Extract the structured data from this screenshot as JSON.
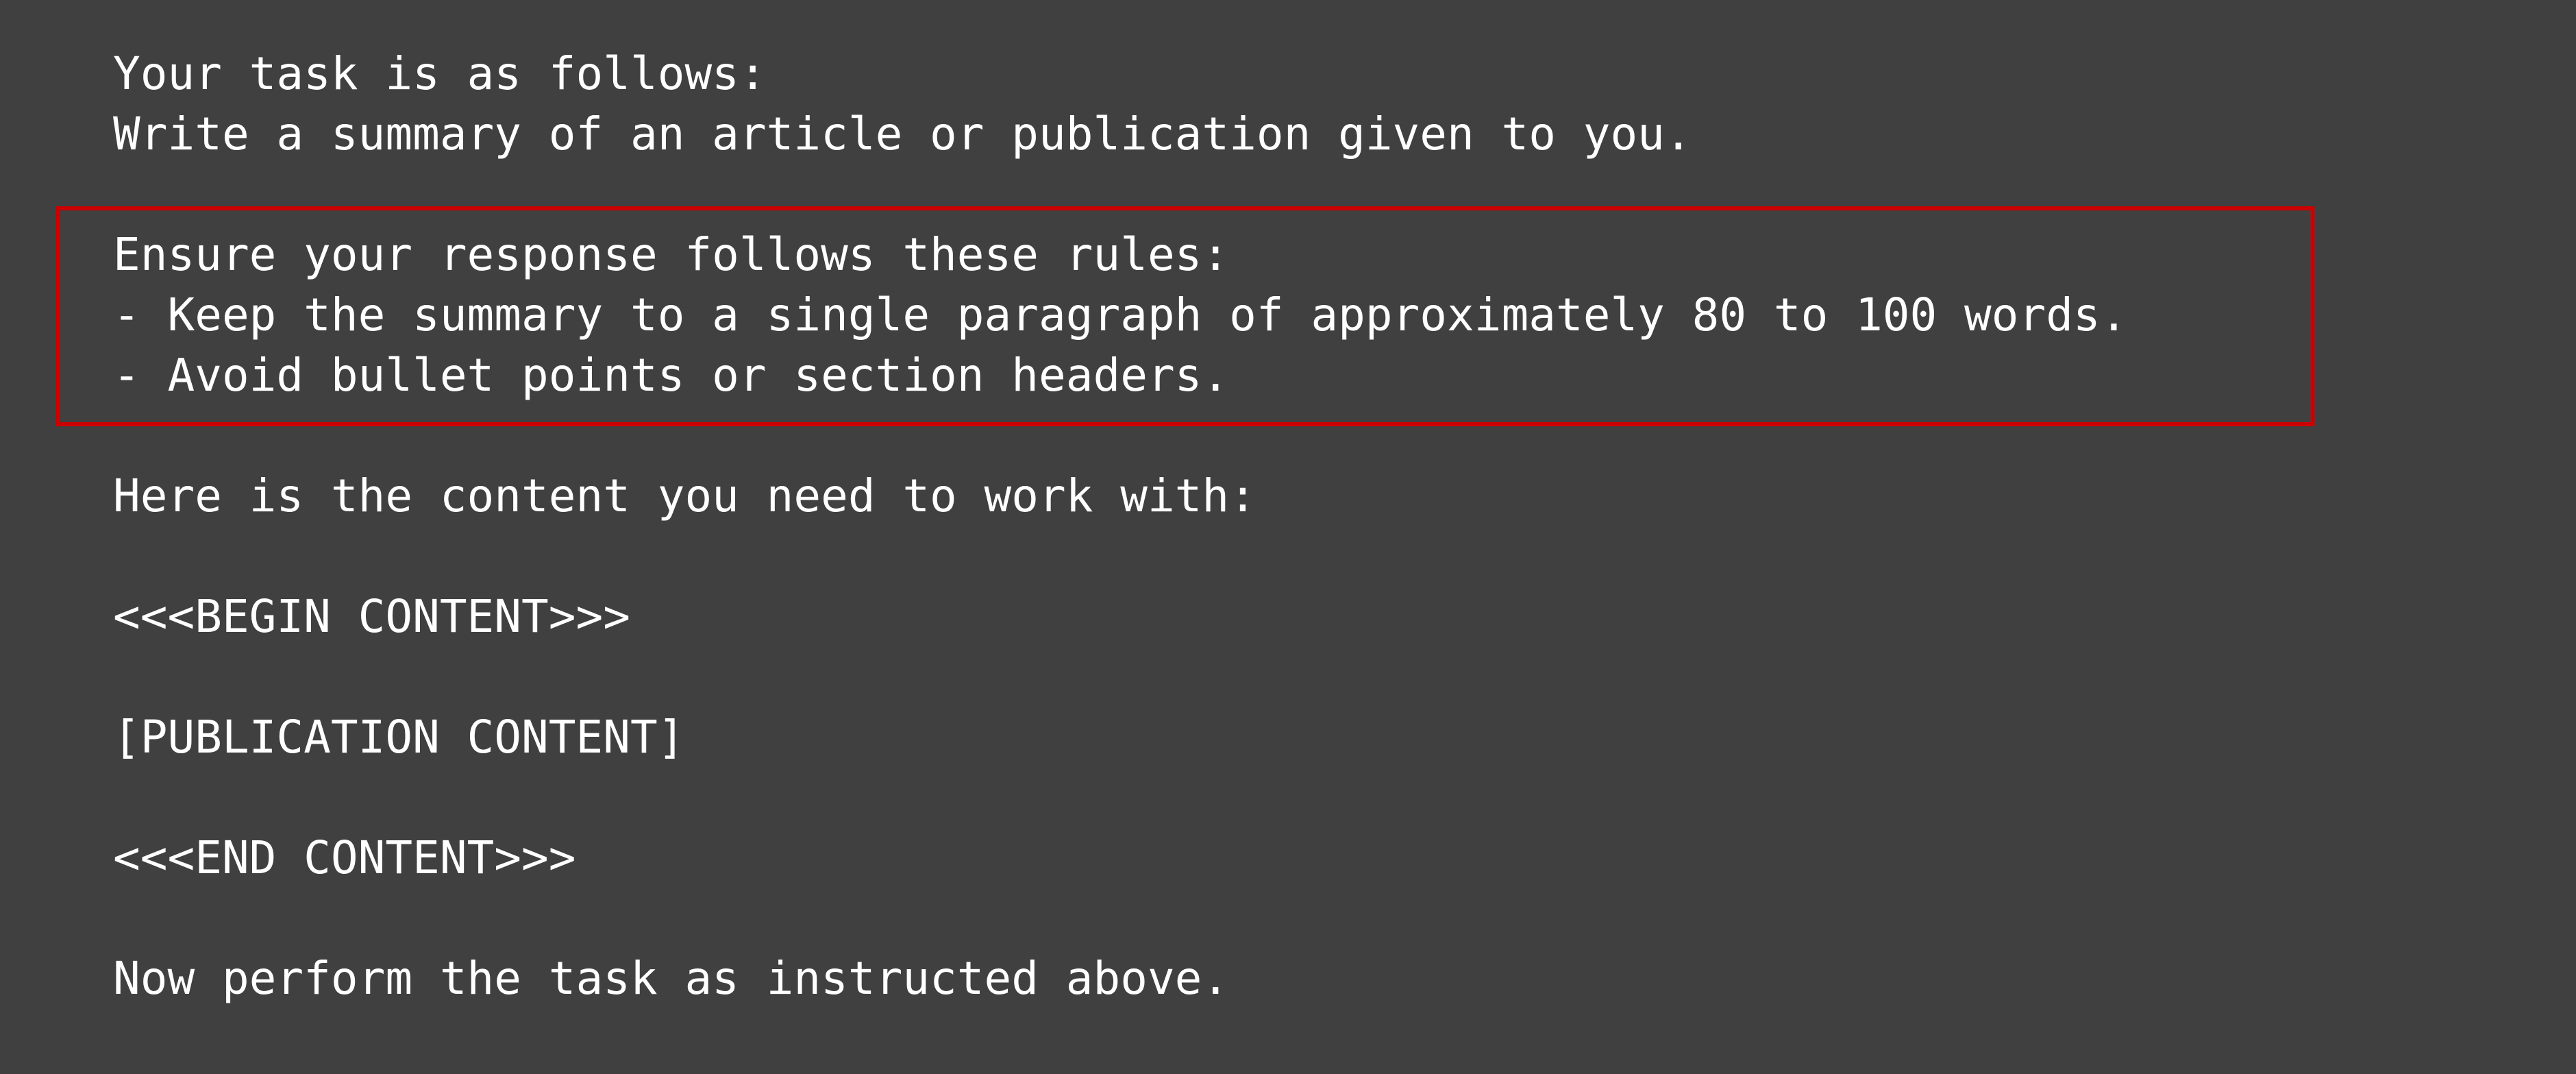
{
  "intro": {
    "line1": "Your task is as follows:",
    "line2": "Write a summary of an article or publication given to you."
  },
  "rules": {
    "heading": "Ensure your response follows these rules:",
    "items": [
      "- Keep the summary to a single paragraph of approximately 80 to 100 words.",
      "- Avoid bullet points or section headers."
    ],
    "highlight_color": "#cc0000"
  },
  "content": {
    "lead": "Here is the content you need to work with:",
    "begin_marker": "<<<BEGIN CONTENT>>>",
    "placeholder": "[PUBLICATION CONTENT]",
    "end_marker": "<<<END CONTENT>>>"
  },
  "closing": "Now perform the task as instructed above.",
  "colors": {
    "background": "#404040",
    "text": "#ffffff"
  }
}
